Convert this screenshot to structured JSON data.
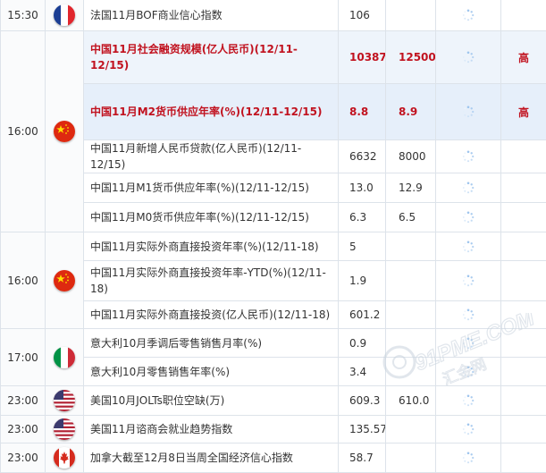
{
  "rows": [
    {
      "time": "15:30",
      "flag": "france-flag-icon",
      "name": "法国11月BOF商业信心指数",
      "previous": "106",
      "forecast": "",
      "importance": ""
    },
    {
      "time": "16:00",
      "flag": "china-flag-icon",
      "name": "中国11月社会融资规模(亿人民币)(12/11-12/15)",
      "previous": "10387",
      "forecast": "12500",
      "importance": "高"
    },
    {
      "name": "中国11月M2货币供应年率(%)(12/11-12/15)",
      "previous": "8.8",
      "forecast": "8.9",
      "importance": "高"
    },
    {
      "name": "中国11月新增人民币贷款(亿人民币)(12/11-12/15)",
      "previous": "6632",
      "forecast": "8000",
      "importance": ""
    },
    {
      "name": "中国11月M1货币供应年率(%)(12/11-12/15)",
      "previous": "13.0",
      "forecast": "12.9",
      "importance": ""
    },
    {
      "name": "中国11月M0货币供应年率(%)(12/11-12/15)",
      "previous": "6.3",
      "forecast": "6.5",
      "importance": ""
    },
    {
      "time": "16:00",
      "flag": "china-flag-icon",
      "name": "中国11月实际外商直接投资年率(%)(12/11-18)",
      "previous": "5",
      "forecast": "",
      "importance": ""
    },
    {
      "name": "中国11月实际外商直接投资年率-YTD(%)(12/11-18)",
      "previous": "1.9",
      "forecast": "",
      "importance": ""
    },
    {
      "name": "中国11月实际外商直接投资(亿人民币)(12/11-18)",
      "previous": "601.2",
      "forecast": "",
      "importance": ""
    },
    {
      "time": "17:00",
      "flag": "italy-flag-icon",
      "name": "意大利10月季调后零售销售月率(%)",
      "previous": "0.9",
      "forecast": "",
      "importance": ""
    },
    {
      "name": "意大利10月零售销售年率(%)",
      "previous": "3.4",
      "forecast": "",
      "importance": ""
    },
    {
      "time": "23:00",
      "flag": "usa-flag-icon",
      "name": "美国10月JOLTs职位空缺(万)",
      "previous": "609.3",
      "forecast": "610.0",
      "importance": ""
    },
    {
      "time": "23:00",
      "flag": "usa-flag-icon",
      "name": "美国11月谘商会就业趋势指数",
      "previous": "135.57",
      "forecast": "",
      "importance": ""
    },
    {
      "time": "23:00",
      "flag": "canada-flag-icon",
      "name": "加拿大截至12月8日当周全国经济信心指数",
      "previous": "58.7",
      "forecast": "",
      "importance": ""
    }
  ],
  "watermark": {
    "domain": "91PME.COM",
    "text": "汇金网"
  },
  "colors": {
    "hot": "#c1121f",
    "highlight": "#eef4fb",
    "border": "#dde3ea"
  }
}
